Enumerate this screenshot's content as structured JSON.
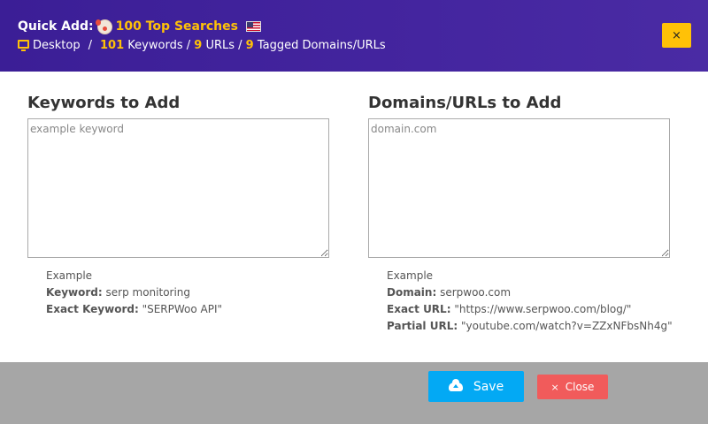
{
  "header": {
    "title_prefix": "Quick Add:",
    "group_name": "100 Top Searches",
    "icons": {
      "group": "clown-face-icon",
      "country": "us-flag-icon"
    },
    "device": "Desktop",
    "separator": "/",
    "keywords_count": "101",
    "keywords_label": "Keywords /",
    "urls_count": "9",
    "urls_label": "URLs /",
    "tagged_count": "9",
    "tagged_label": "Tagged Domains/URLs",
    "close_icon": "×"
  },
  "keywords": {
    "heading": "Keywords to Add",
    "placeholder": "example keyword",
    "example_title": "Example",
    "lines": [
      {
        "label": "Keyword:",
        "value": "serp monitoring"
      },
      {
        "label": "Exact Keyword:",
        "value": "\"SERPWoo API\""
      }
    ]
  },
  "domains": {
    "heading": "Domains/URLs to Add",
    "placeholder": "domain.com",
    "example_title": "Example",
    "lines": [
      {
        "label": "Domain:",
        "value": "serpwoo.com"
      },
      {
        "label": "Exact URL:",
        "value": "\"https://www.serpwoo.com/blog/\""
      },
      {
        "label": "Partial URL:",
        "value": "\"youtube.com/watch?v=ZZxNFbsNh4g\""
      }
    ]
  },
  "footer": {
    "save_label": "Save",
    "close_label": "Close",
    "close_icon": "×"
  },
  "colors": {
    "header_bg": "#3b1e96",
    "accent": "#ffc107",
    "save": "#03a9f4",
    "close": "#f15b5b"
  }
}
